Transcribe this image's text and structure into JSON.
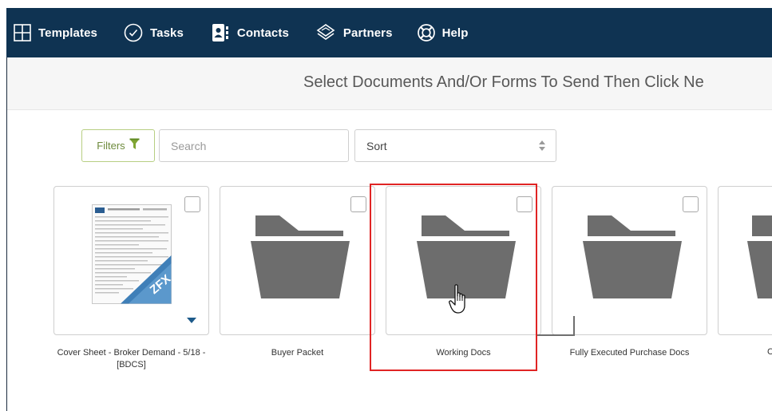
{
  "nav": {
    "items": [
      {
        "id": "templates",
        "label": "Templates",
        "icon": "grid-icon"
      },
      {
        "id": "tasks",
        "label": "Tasks",
        "icon": "check-circle-icon"
      },
      {
        "id": "contacts",
        "label": "Contacts",
        "icon": "address-book-icon"
      },
      {
        "id": "partners",
        "label": "Partners",
        "icon": "handshake-icon"
      },
      {
        "id": "help",
        "label": "Help",
        "icon": "lifebuoy-icon"
      }
    ]
  },
  "instruction": {
    "text": "Select Documents And/Or Forms To Send Then Click Ne"
  },
  "controls": {
    "filters_label": "Filters",
    "search_placeholder": "Search",
    "sort_label": "Sort"
  },
  "cards": [
    {
      "label": "Cover Sheet - Broker Demand - 5/18 - [BDCS]",
      "type": "document",
      "thumb_badge": "ZFX"
    },
    {
      "label": "Buyer Packet",
      "type": "folder"
    },
    {
      "label": "Working Docs",
      "type": "folder",
      "highlighted": true
    },
    {
      "label": "Fully Executed Purchase Docs",
      "type": "folder"
    },
    {
      "label": "C",
      "type": "folder",
      "partial": true
    }
  ],
  "colors": {
    "nav_bg": "#0f3352",
    "filter_accent": "#7fa533",
    "folder_gray": "#6d6d6d",
    "highlight_red": "#e02424",
    "caret_blue": "#1d5a8a"
  }
}
